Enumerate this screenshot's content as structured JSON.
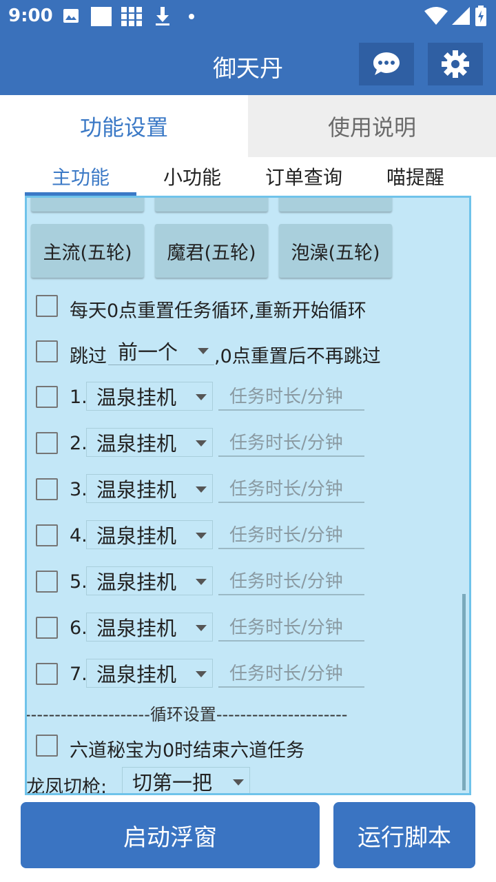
{
  "status": {
    "time": "9:00"
  },
  "appbar": {
    "title": "御天丹",
    "chat_icon": "chat-bubble-icon",
    "settings_icon": "gear-icon"
  },
  "tabs": {
    "features": "功能设置",
    "instructions": "使用说明"
  },
  "subtabs": {
    "main": "主功能",
    "minor": "小功能",
    "orders": "订单查询",
    "remind": "喵提醒"
  },
  "mode_buttons": [
    {
      "label": "主流(五轮)"
    },
    {
      "label": "魔君(五轮)"
    },
    {
      "label": "泡澡(五轮)"
    }
  ],
  "options": {
    "daily_reset": "每天0点重置任务循环,重新开始循环",
    "skip_label": "跳过",
    "skip_select": "前一个",
    "skip_suffix": ",0点重置后不再跳过"
  },
  "tasks": [
    {
      "index": "1.",
      "task": "温泉挂机",
      "duration_placeholder": "任务时长/分钟"
    },
    {
      "index": "2.",
      "task": "温泉挂机",
      "duration_placeholder": "任务时长/分钟"
    },
    {
      "index": "3.",
      "task": "温泉挂机",
      "duration_placeholder": "任务时长/分钟"
    },
    {
      "index": "4.",
      "task": "温泉挂机",
      "duration_placeholder": "任务时长/分钟"
    },
    {
      "index": "5.",
      "task": "温泉挂机",
      "duration_placeholder": "任务时长/分钟"
    },
    {
      "index": "6.",
      "task": "温泉挂机",
      "duration_placeholder": "任务时长/分钟"
    },
    {
      "index": "7.",
      "task": "温泉挂机",
      "duration_placeholder": "任务时长/分钟"
    }
  ],
  "loop_divider": "---------------------循环设置----------------------",
  "liudao": "六道秘宝为0时结束六道任务",
  "longfeng": {
    "label": "龙凤切枪:",
    "select": "切第一把"
  },
  "buttons": {
    "float": "启动浮窗",
    "run": "运行脚本"
  },
  "colors": {
    "primary": "#3a71bb",
    "panel_bg": "#c3e7f7",
    "panel_border": "#6fc3ea"
  }
}
